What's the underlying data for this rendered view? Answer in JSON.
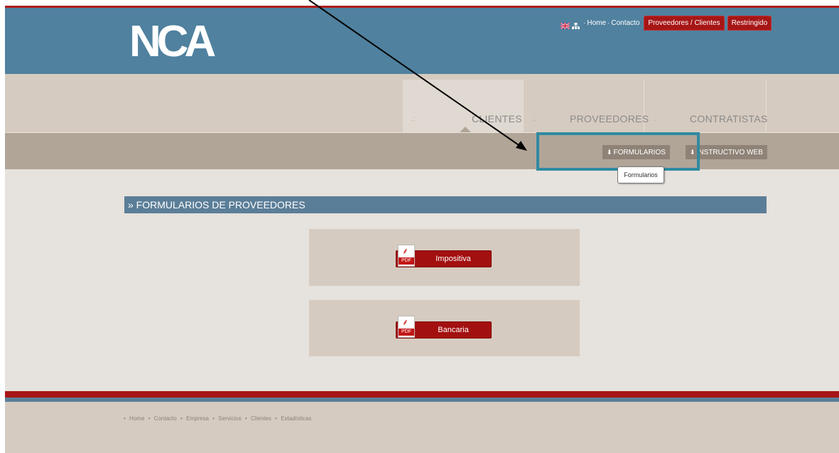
{
  "header": {
    "logo_text": "NCA",
    "utility_links": [
      "Home",
      "Contacto"
    ],
    "utility_sep": "·",
    "utility_buttons": [
      "Proveedores / Clientes",
      "Restringido"
    ]
  },
  "nav": {
    "tabs": [
      "CLIENTES",
      "PROVEEDORES",
      "CONTRATISTAS"
    ],
    "dots": ".:"
  },
  "subnav": {
    "buttons": [
      "FORMULARIOS",
      "INSTRUCTIVO WEB"
    ],
    "tooltip": "Formularios"
  },
  "section": {
    "title": "» FORMULARIOS DE PROVEEDORES",
    "downloads": [
      "Impositiva",
      "Bancaria"
    ],
    "pdf_tag": "PDF"
  },
  "footer": {
    "links": [
      "Home",
      "Contacto",
      "Empresa",
      "Servicios",
      "Clientes",
      "Estadísticas"
    ],
    "bullet": "•"
  },
  "colors": {
    "header_blue": "#50819f",
    "brand_red": "#a71616",
    "highlight_box": "#2f8aa1",
    "section_bar": "#5b7e98"
  }
}
